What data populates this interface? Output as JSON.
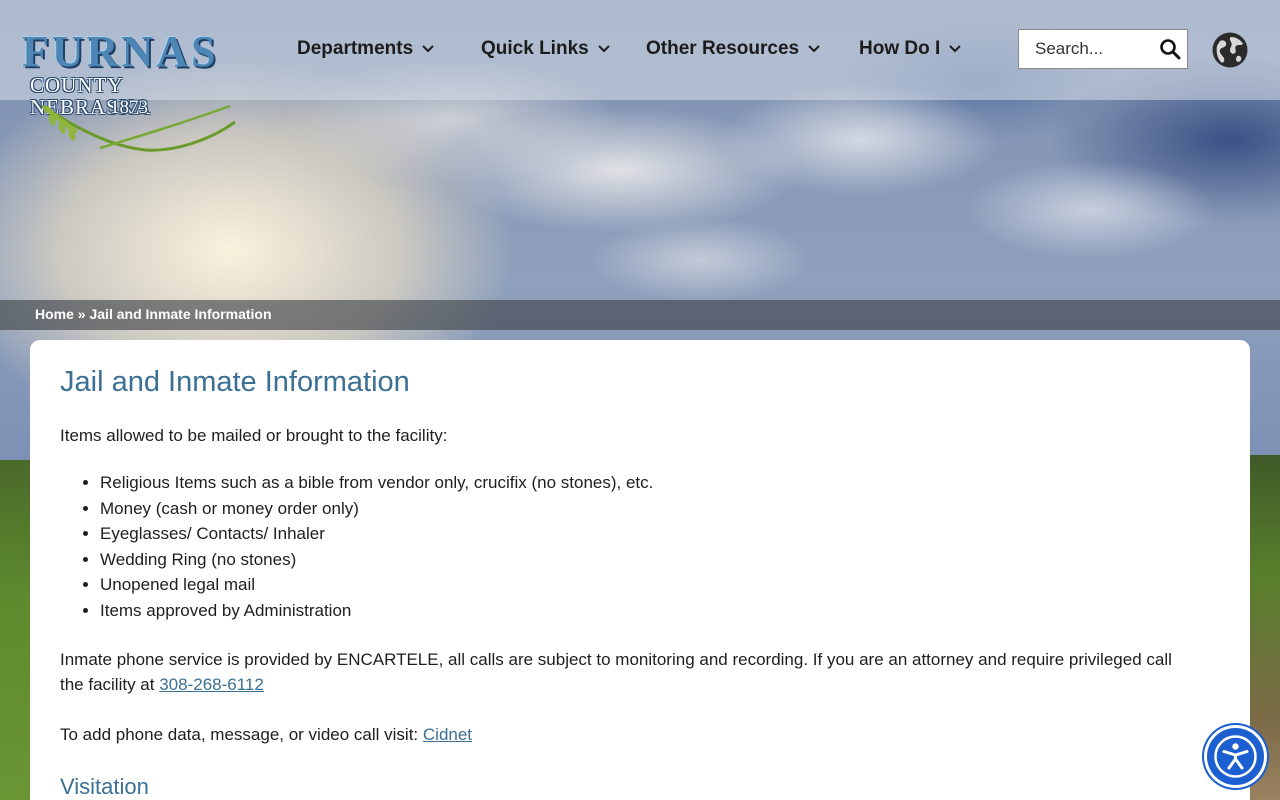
{
  "logo": {
    "title": "FURNAS",
    "subtitle": "COUNTY NEBRASKA",
    "year": "1873"
  },
  "nav": {
    "items": [
      {
        "label": "Departments"
      },
      {
        "label": "Quick Links"
      },
      {
        "label": "Other Resources"
      },
      {
        "label": "How Do I"
      }
    ]
  },
  "search": {
    "placeholder": "Search..."
  },
  "breadcrumb": {
    "home": "Home",
    "separator": " » ",
    "current": "Jail and Inmate Information"
  },
  "content": {
    "title": "Jail and Inmate Information",
    "intro": "Items allowed to be mailed or brought to the facility:",
    "items": [
      "Religious Items such as a bible from vendor only, crucifix (no stones), etc.",
      "Money (cash or money order only)",
      "Eyeglasses/ Contacts/ Inhaler",
      "Wedding Ring (no stones)",
      "Unopened legal mail",
      "Items approved by Administration"
    ],
    "phone_text": "Inmate phone service is provided by ENCARTELE, all calls are subject to monitoring and recording. If you are an attorney and require privileged call the facility at ",
    "phone_link": "308-268-6112",
    "cidnet_text": "To add phone data, message, or video call visit: ",
    "cidnet_link": "Cidnet",
    "visitation_heading": "Visitation"
  },
  "colors": {
    "accent": "#3b6f93",
    "a11y_button": "#1b5fd0",
    "breadcrumb_bg": "#3c4046"
  },
  "icons": {
    "search": "search-icon",
    "globe": "globe-icon",
    "chevron": "chevron-down-icon",
    "accessibility": "accessibility-icon"
  }
}
